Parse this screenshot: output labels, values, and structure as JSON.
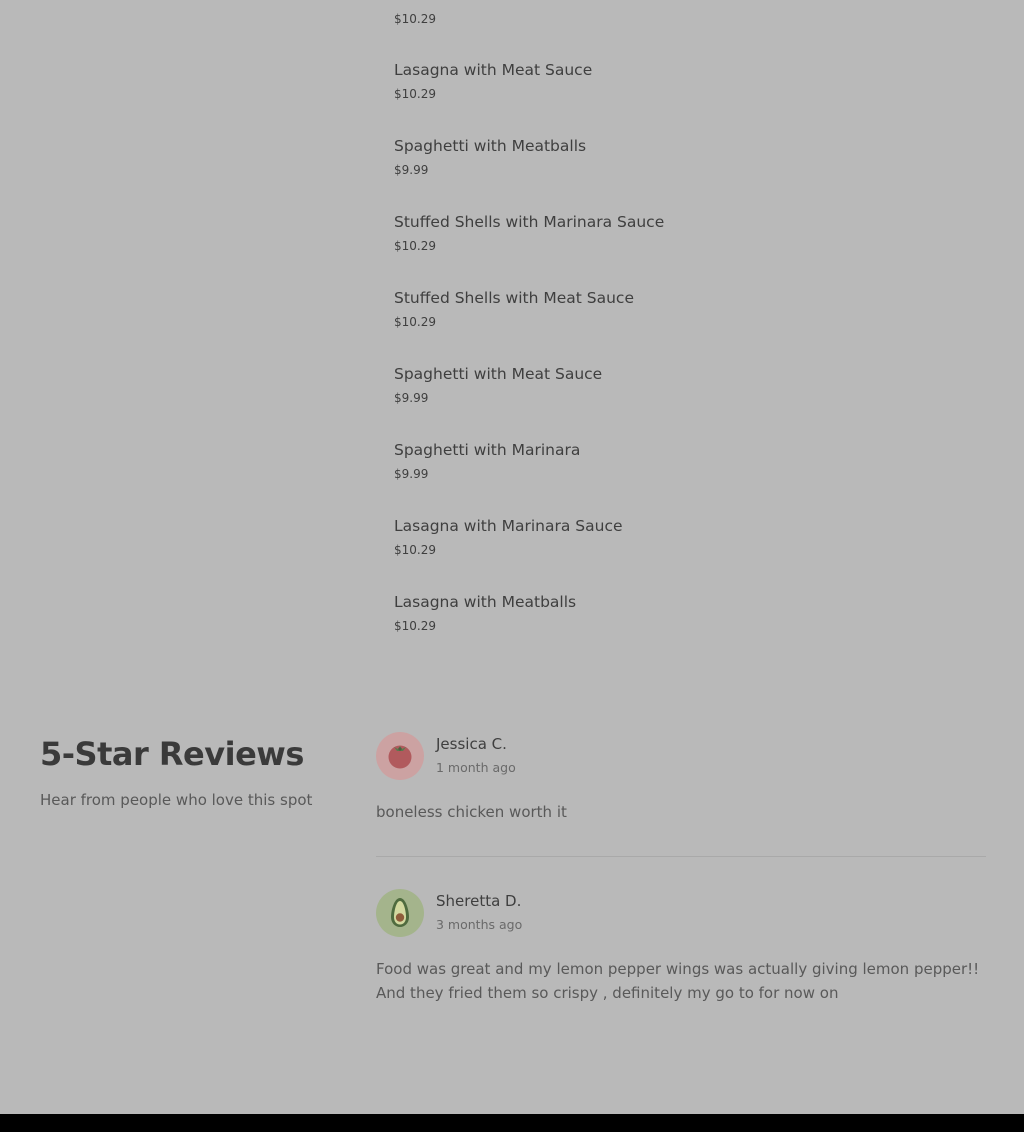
{
  "menu": {
    "top_price": "$10.29",
    "items": [
      {
        "name": "Lasagna with Meat Sauce",
        "price": "$10.29"
      },
      {
        "name": "Spaghetti with Meatballs",
        "price": "$9.99"
      },
      {
        "name": "Stuffed Shells with Marinara Sauce",
        "price": "$10.29"
      },
      {
        "name": "Stuffed Shells with Meat Sauce",
        "price": "$10.29"
      },
      {
        "name": "Spaghetti with Meat Sauce",
        "price": "$9.99"
      },
      {
        "name": "Spaghetti with Marinara",
        "price": "$9.99"
      },
      {
        "name": "Lasagna with Marinara Sauce",
        "price": "$10.29"
      },
      {
        "name": "Lasagna with Meatballs",
        "price": "$10.29"
      }
    ]
  },
  "reviews": {
    "title": "5-Star Reviews",
    "subtitle": "Hear from people who love this spot",
    "items": [
      {
        "name": "Jessica C.",
        "time": "1 month ago",
        "text": "boneless chicken worth it",
        "avatar_icon": "tomato-icon"
      },
      {
        "name": "Sheretta D.",
        "time": "3 months ago",
        "text": "Food was great and my lemon pepper wings was actually giving lemon pepper!! And they fried them so crispy , definitely my go to for now on",
        "avatar_icon": "avocado-icon"
      }
    ]
  },
  "colors": {
    "page_background": "#b9b9b9",
    "footer": "#000000",
    "tomato_avatar_bg": "#cca2a2",
    "avocado_avatar_bg": "#a4b48c"
  }
}
